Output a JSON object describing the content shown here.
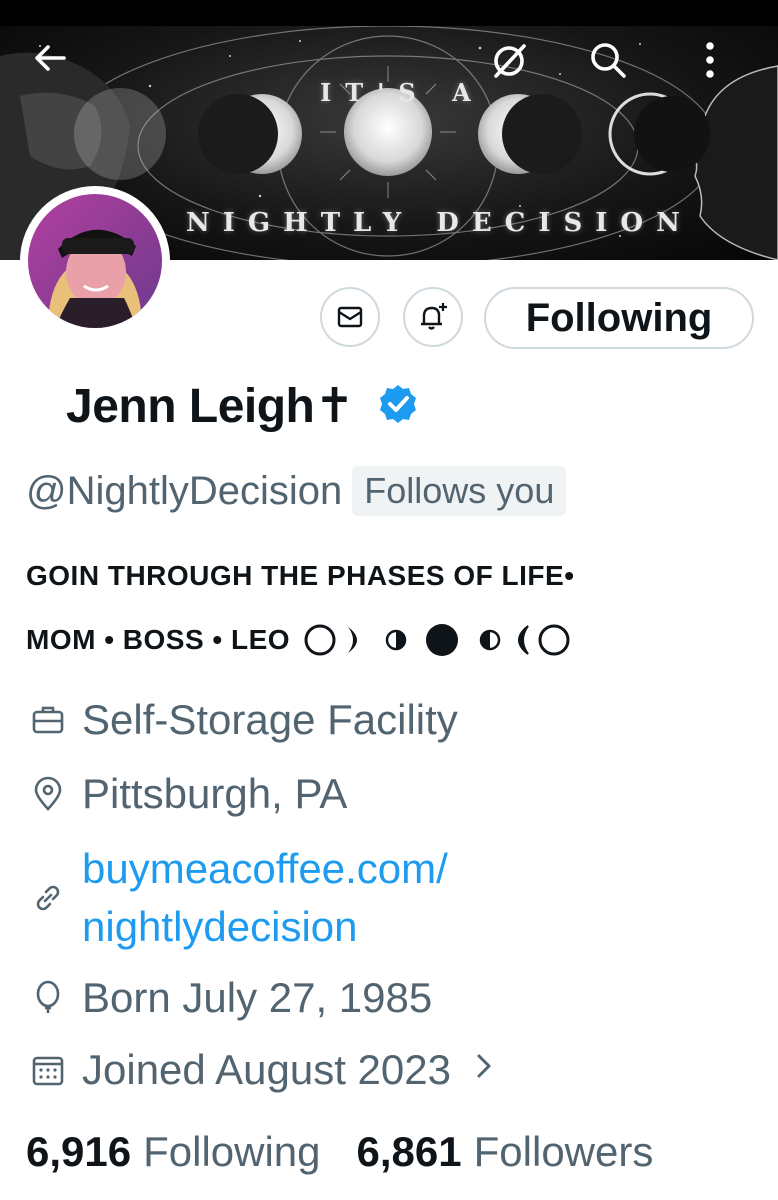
{
  "banner": {
    "line1": "IT'S A",
    "line2": "NIGHTLY DECISION"
  },
  "actions": {
    "follow_label": "Following"
  },
  "profile": {
    "name": "Jenn Leigh✝",
    "handle": "@NightlyDecision",
    "follows_you": "Follows you",
    "bio_line1": "GOIN THROUGH THE PHASES OF LIFE•",
    "bio_line2": "MOM • BOSS • LEO"
  },
  "info": {
    "profession": "Self-Storage Facility",
    "location": "Pittsburgh, PA",
    "link_line1": "buymeacoffee.com/",
    "link_line2": "nightlydecision",
    "born": "Born July 27, 1985",
    "joined": "Joined August 2023"
  },
  "stats": {
    "following_count": "6,916",
    "following_label": "Following",
    "followers_count": "6,861",
    "followers_label": "Followers"
  },
  "icons": [
    "back-arrow-icon",
    "grok-icon",
    "search-icon",
    "more-icon",
    "mail-icon",
    "bell-plus-icon",
    "verified-icon",
    "briefcase-icon",
    "location-icon",
    "link-icon",
    "balloon-icon",
    "calendar-icon",
    "chevron-right-icon"
  ],
  "colors": {
    "link": "#1d9bf0",
    "secondary_text": "#536471",
    "verified": "#1d9bf0"
  }
}
